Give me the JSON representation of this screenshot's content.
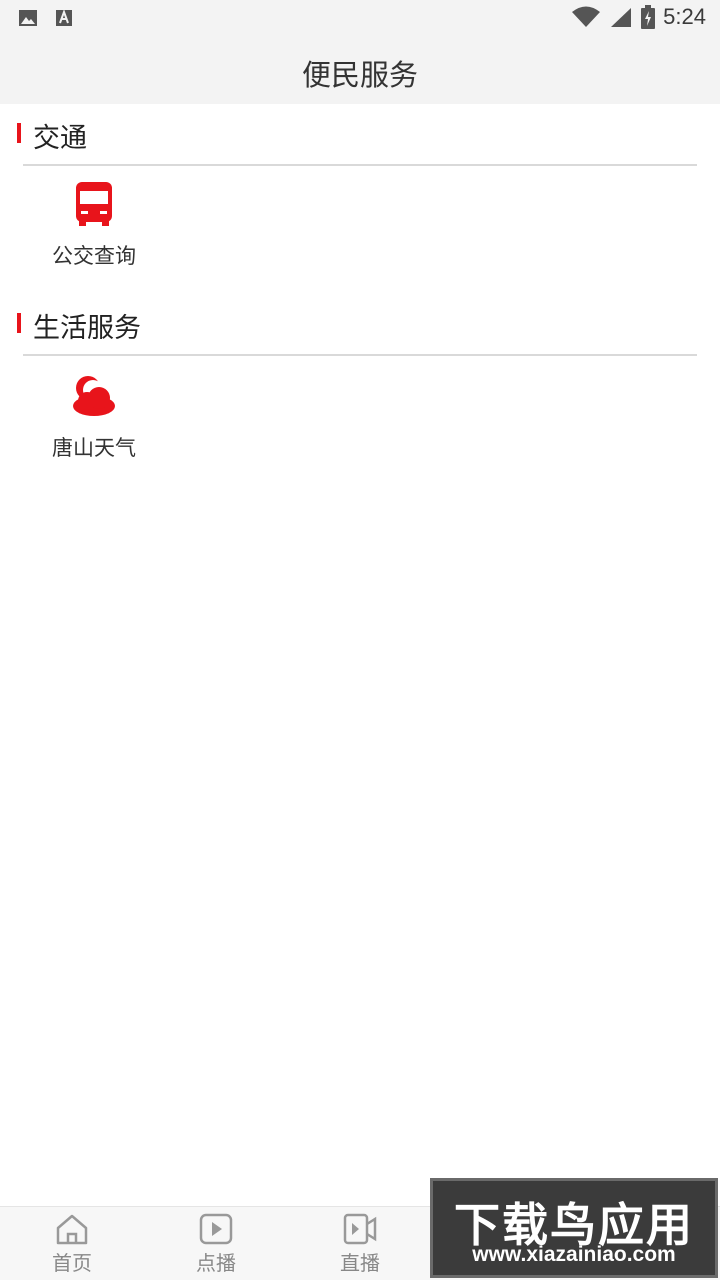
{
  "status_bar": {
    "time": "5:24",
    "left_icons": [
      "image-icon",
      "font-icon"
    ],
    "right_icons": [
      "wifi-icon",
      "signal-icon",
      "battery-charging-icon"
    ]
  },
  "header": {
    "title": "便民服务"
  },
  "sections": [
    {
      "title": "交通",
      "items": [
        {
          "label": "公交查询",
          "icon": "bus-icon"
        }
      ]
    },
    {
      "title": "生活服务",
      "items": [
        {
          "label": "唐山天气",
          "icon": "weather-cloud-icon"
        }
      ]
    }
  ],
  "bottom_nav": {
    "items": [
      {
        "label": "首页",
        "icon": "home-icon"
      },
      {
        "label": "点播",
        "icon": "play-icon"
      },
      {
        "label": "直播",
        "icon": "video-icon"
      }
    ]
  },
  "watermark": {
    "title": "下载鸟应用",
    "url": "www.xiazainiao.com"
  },
  "colors": {
    "accent": "#e8141b",
    "header_bg": "#f3f3f3",
    "text": "#333333"
  }
}
